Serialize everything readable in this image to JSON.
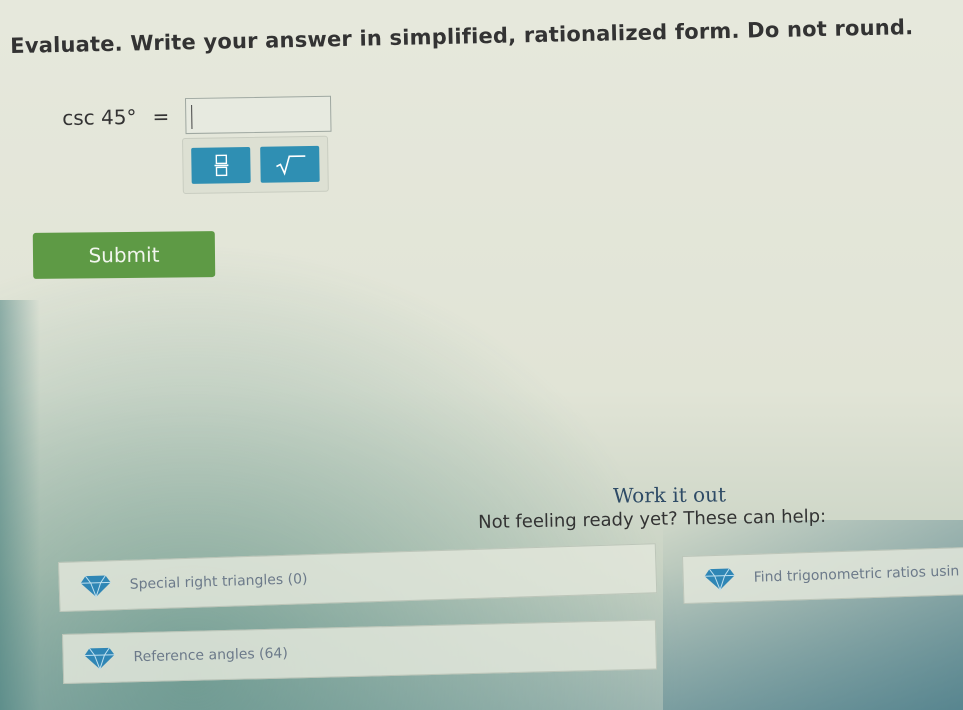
{
  "question": {
    "prompt": "Evaluate. Write your answer in simplified, rationalized form. Do not round.",
    "expression": "csc 45°",
    "equals": "=",
    "answer_value": ""
  },
  "toolbar": {
    "fraction_icon": "fraction-icon",
    "sqrt_icon": "square-root-icon"
  },
  "actions": {
    "submit_label": "Submit"
  },
  "help": {
    "title": "Work it out",
    "subtitle": "Not feeling ready yet? These can help:",
    "items": [
      {
        "label": "Special right triangles (0)",
        "icon": "gem-icon"
      },
      {
        "label": "Find trigonometric ratios usin",
        "icon": "gem-icon"
      },
      {
        "label": "Reference angles (64)",
        "icon": "gem-icon"
      }
    ]
  },
  "colors": {
    "submit_green": "#5e9a45",
    "tool_blue": "#2f8fb3",
    "title_blue": "#2e4b66",
    "gem_blue": "#2f86b5"
  }
}
